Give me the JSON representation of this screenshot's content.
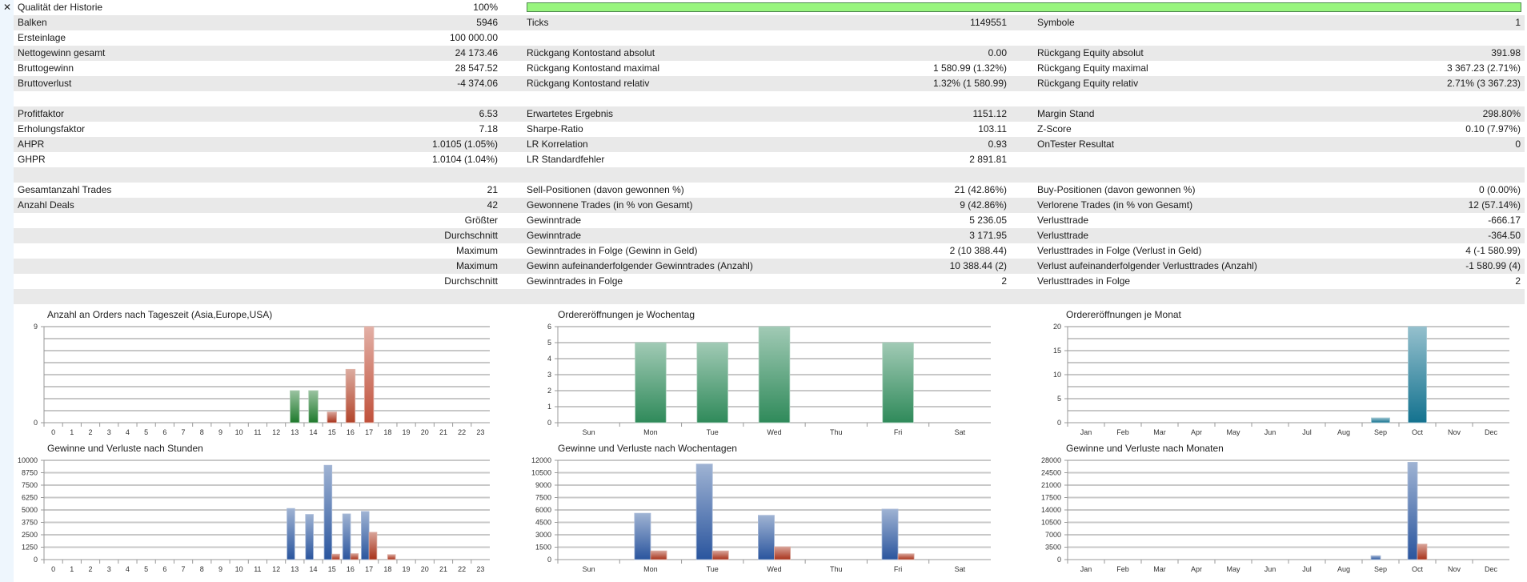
{
  "header": {
    "close_icon": "close-x-icon"
  },
  "quality": {
    "label": "Qualität der Historie",
    "value": "100%",
    "progress_percent": 100,
    "bar_color": "#98f57e"
  },
  "rows": [
    {
      "l1": "",
      "v1": "",
      "l2": "",
      "v2": "",
      "l3": "",
      "v3": ""
    },
    {
      "l1": "Balken",
      "v1": "5946",
      "l2": "Ticks",
      "v2": "1149551",
      "l3": "Symbole",
      "v3": "1"
    },
    {
      "l1": "Ersteinlage",
      "v1": "100 000.00",
      "l2": "",
      "v2": "",
      "l3": "",
      "v3": ""
    },
    {
      "l1": "Nettogewinn gesamt",
      "v1": "24 173.46",
      "l2": "Rückgang Kontostand absolut",
      "v2": "0.00",
      "l3": "Rückgang Equity absolut",
      "v3": "391.98"
    },
    {
      "l1": "Bruttogewinn",
      "v1": "28 547.52",
      "l2": "Rückgang Kontostand maximal",
      "v2": "1 580.99 (1.32%)",
      "l3": "Rückgang Equity maximal",
      "v3": "3 367.23 (2.71%)"
    },
    {
      "l1": "Bruttoverlust",
      "v1": "-4 374.06",
      "l2": "Rückgang Kontostand relativ",
      "v2": "1.32% (1 580.99)",
      "l3": "Rückgang Equity relativ",
      "v3": "2.71% (3 367.23)"
    },
    {
      "l1": "",
      "v1": "",
      "l2": "",
      "v2": "",
      "l3": "",
      "v3": ""
    },
    {
      "l1": "Profitfaktor",
      "v1": "6.53",
      "l2": "Erwartetes Ergebnis",
      "v2": "1151.12",
      "l3": "Margin Stand",
      "v3": "298.80%"
    },
    {
      "l1": "Erholungsfaktor",
      "v1": "7.18",
      "l2": "Sharpe-Ratio",
      "v2": "103.11",
      "l3": "Z-Score",
      "v3": "0.10 (7.97%)"
    },
    {
      "l1": "AHPR",
      "v1": "1.0105 (1.05%)",
      "l2": "LR Korrelation",
      "v2": "0.93",
      "l3": "OnTester Resultat",
      "v3": "0"
    },
    {
      "l1": "GHPR",
      "v1": "1.0104 (1.04%)",
      "l2": "LR Standardfehler",
      "v2": "2 891.81",
      "l3": "",
      "v3": ""
    },
    {
      "l1": "",
      "v1": "",
      "l2": "",
      "v2": "",
      "l3": "",
      "v3": ""
    },
    {
      "l1": "Gesamtanzahl Trades",
      "v1": "21",
      "l2": "Sell-Positionen (davon gewonnen %)",
      "v2": "21 (42.86%)",
      "l3": "Buy-Positionen (davon gewonnen %)",
      "v3": "0 (0.00%)"
    },
    {
      "l1": "Anzahl Deals",
      "v1": "42",
      "l2": "Gewonnene Trades (in % von Gesamt)",
      "v2": "9 (42.86%)",
      "l3": "Verlorene Trades (in % von Gesamt)",
      "v3": "12 (57.14%)"
    },
    {
      "l1": "",
      "v1": "Größter",
      "l2": "Gewinntrade",
      "v2": "5 236.05",
      "l3": "Verlusttrade",
      "v3": "-666.17"
    },
    {
      "l1": "",
      "v1": "Durchschnitt",
      "l2": "Gewinntrade",
      "v2": "3 171.95",
      "l3": "Verlusttrade",
      "v3": "-364.50"
    },
    {
      "l1": "",
      "v1": "Maximum",
      "l2": "Gewinntrades in Folge (Gewinn in Geld)",
      "v2": "2 (10 388.44)",
      "l3": "Verlusttrades in Folge (Verlust in Geld)",
      "v3": "4 (-1 580.99)"
    },
    {
      "l1": "",
      "v1": "Maximum",
      "l2": "Gewinn aufeinanderfolgender Gewinntrades (Anzahl)",
      "v2": "10 388.44 (2)",
      "l3": "Verlust aufeinanderfolgender Verlusttrades (Anzahl)",
      "v3": "-1 580.99 (4)"
    },
    {
      "l1": "",
      "v1": "Durchschnitt",
      "l2": "Gewinntrades in Folge",
      "v2": "2",
      "l3": "Verlusttrades in Folge",
      "v3": "2"
    },
    {
      "l1": "",
      "v1": "",
      "l2": "",
      "v2": "",
      "l3": "",
      "v3": ""
    }
  ],
  "chart_data": [
    {
      "type": "bar",
      "title": "Anzahl an Orders nach Tageszeit (Asia,Europe,USA)",
      "categories": [
        "0",
        "1",
        "2",
        "3",
        "4",
        "5",
        "6",
        "7",
        "8",
        "9",
        "10",
        "11",
        "12",
        "13",
        "14",
        "15",
        "16",
        "17",
        "18",
        "19",
        "20",
        "21",
        "22",
        "23"
      ],
      "series": [
        {
          "values": [
            0,
            0,
            0,
            0,
            0,
            0,
            0,
            0,
            0,
            0,
            0,
            0,
            0,
            3,
            3,
            1,
            5,
            9,
            0,
            0,
            0,
            0,
            0,
            0
          ],
          "colors": {
            "13": "#1e7a2c",
            "14": "#1e7a2c",
            "15": "#a8321a",
            "16": "#b2442a",
            "17": "#c0503a"
          }
        }
      ],
      "ylim": [
        0,
        9
      ],
      "yticks": [
        0,
        9
      ],
      "grid_intervals": 8,
      "grid": true
    },
    {
      "type": "bar",
      "title": "Ordereröffnungen je Wochentag",
      "categories": [
        "Sun",
        "Mon",
        "Tue",
        "Wed",
        "Thu",
        "Fri",
        "Sat"
      ],
      "series": [
        {
          "values": [
            0,
            5,
            5,
            6,
            0,
            5,
            0
          ],
          "color": "#2f8a5a"
        }
      ],
      "ylim": [
        0,
        6
      ],
      "yticks": [
        0,
        1,
        2,
        3,
        4,
        5,
        6
      ],
      "grid_intervals": 6,
      "grid": true
    },
    {
      "type": "bar",
      "title": "Ordereröffnungen je Monat",
      "categories": [
        "Jan",
        "Feb",
        "Mar",
        "Apr",
        "May",
        "Jun",
        "Jul",
        "Aug",
        "Sep",
        "Oct",
        "Nov",
        "Dec"
      ],
      "series": [
        {
          "values": [
            0,
            0,
            0,
            0,
            0,
            0,
            0,
            0,
            1,
            20,
            0,
            0
          ],
          "color": "#13728f"
        }
      ],
      "ylim": [
        0,
        20
      ],
      "yticks": [
        0,
        5,
        10,
        15,
        20
      ],
      "grid_intervals": 8,
      "grid": true
    },
    {
      "type": "bar",
      "title": "Gewinne und Verluste nach Stunden",
      "categories": [
        "0",
        "1",
        "2",
        "3",
        "4",
        "5",
        "6",
        "7",
        "8",
        "9",
        "10",
        "11",
        "12",
        "13",
        "14",
        "15",
        "16",
        "17",
        "18",
        "19",
        "20",
        "21",
        "22",
        "23"
      ],
      "series": [
        {
          "values": [
            0,
            0,
            0,
            0,
            0,
            0,
            0,
            0,
            0,
            0,
            0,
            0,
            0,
            5150,
            4550,
            9500,
            4600,
            4850,
            0,
            0,
            0,
            0,
            0,
            0
          ],
          "color": "#2a559e"
        },
        {
          "values": [
            0,
            0,
            0,
            0,
            0,
            0,
            0,
            0,
            0,
            0,
            0,
            0,
            0,
            0,
            0,
            550,
            600,
            2750,
            500,
            0,
            0,
            0,
            0,
            0
          ],
          "color": "#a8321a"
        }
      ],
      "ylim": [
        0,
        10000
      ],
      "yticks": [
        0,
        1250,
        2500,
        3750,
        5000,
        6250,
        7500,
        8750,
        10000
      ],
      "grid_intervals": 8,
      "grid": true
    },
    {
      "type": "bar",
      "title": "Gewinne und Verluste nach Wochentagen",
      "categories": [
        "Sun",
        "Mon",
        "Tue",
        "Wed",
        "Thu",
        "Fri",
        "Sat"
      ],
      "series": [
        {
          "values": [
            0,
            5600,
            11550,
            5350,
            0,
            6100,
            0
          ],
          "color": "#2a559e"
        },
        {
          "values": [
            0,
            1050,
            1050,
            1550,
            0,
            700,
            0
          ],
          "color": "#a8321a"
        }
      ],
      "ylim": [
        0,
        12000
      ],
      "yticks": [
        0,
        1500,
        3000,
        4500,
        6000,
        7500,
        9000,
        10500,
        12000
      ],
      "grid_intervals": 8,
      "grid": true
    },
    {
      "type": "bar",
      "title": "Gewinne und Verluste nach Monaten",
      "categories": [
        "Jan",
        "Feb",
        "Mar",
        "Apr",
        "May",
        "Jun",
        "Jul",
        "Aug",
        "Sep",
        "Oct",
        "Nov",
        "Dec"
      ],
      "series": [
        {
          "values": [
            0,
            0,
            0,
            0,
            0,
            0,
            0,
            0,
            1100,
            27450,
            0,
            0
          ],
          "color": "#2a559e"
        },
        {
          "values": [
            0,
            0,
            0,
            0,
            0,
            0,
            0,
            0,
            0,
            4374,
            0,
            0
          ],
          "color": "#a8321a"
        }
      ],
      "ylim": [
        0,
        28000
      ],
      "yticks": [
        0,
        3500,
        7000,
        10500,
        14000,
        17500,
        21000,
        24500,
        28000
      ],
      "grid_intervals": 8,
      "grid": true
    }
  ]
}
